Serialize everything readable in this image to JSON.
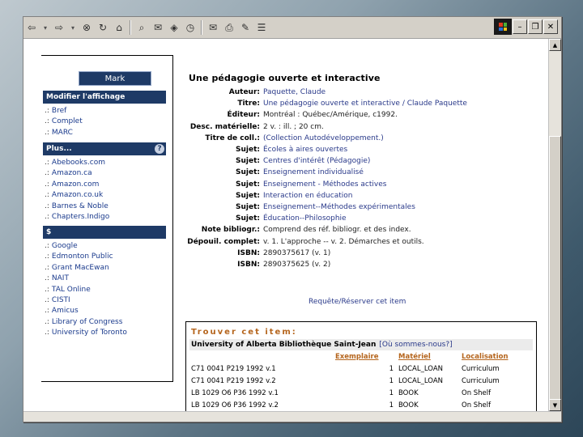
{
  "toolbar": {
    "buttons": [
      {
        "icon": "back-arrow-icon",
        "glyph": "⇦"
      },
      {
        "icon": "dropdown-caret-icon",
        "glyph": "▾"
      },
      {
        "icon": "forward-arrow-icon",
        "glyph": "⇨"
      },
      {
        "icon": "dropdown-caret-icon",
        "glyph": "▾"
      },
      {
        "icon": "stop-icon",
        "glyph": "⊗"
      },
      {
        "icon": "refresh-icon",
        "glyph": "↻"
      },
      {
        "icon": "home-icon",
        "glyph": "⌂"
      },
      {
        "icon": "search-icon",
        "glyph": "⌕"
      },
      {
        "icon": "favorites-icon",
        "glyph": "✉"
      },
      {
        "icon": "media-icon",
        "glyph": "◈"
      },
      {
        "icon": "history-icon",
        "glyph": "◷"
      },
      {
        "icon": "mail-icon",
        "glyph": "✉"
      },
      {
        "icon": "print-icon",
        "glyph": "⎙"
      },
      {
        "icon": "edit-icon",
        "glyph": "✎"
      },
      {
        "icon": "discuss-icon",
        "glyph": "☰"
      }
    ],
    "window_controls": {
      "minimize": "–",
      "restore": "❐",
      "close": "✕"
    }
  },
  "sidebar": {
    "mark_label": "Mark",
    "display_heading": "Modifier l'affichage",
    "display_items": [
      "Bref",
      "Complet",
      "MARC"
    ],
    "more_heading": "Plus...",
    "help_icon": "?",
    "more_items": [
      "Abebooks.com",
      "Amazon.ca",
      "Amazon.com",
      "Amazon.co.uk",
      "Barnes & Noble",
      "Chapters.Indigo"
    ],
    "dollar_heading": "$",
    "dollar_items": [
      "Google",
      "Edmonton Public",
      "Grant MacEwan",
      "NAIT",
      "TAL Online",
      "CISTI",
      "Amicus",
      "Library of Congress",
      "University of Toronto"
    ],
    "bullet": ".:"
  },
  "record": {
    "title": "Une pédagogie ouverte et interactive",
    "fields": [
      {
        "label": "Auteur:",
        "value": "Paquette, Claude",
        "link": true
      },
      {
        "label": "Titre:",
        "value": "Une pédagogie ouverte et interactive / Claude Paquette",
        "link": true
      },
      {
        "label": "Éditeur:",
        "value": "Montréal : Québec/Amérique, c1992.",
        "link": false
      },
      {
        "label": "Desc. matérielle:",
        "value": "2 v. : ill. ; 20 cm.",
        "link": false
      },
      {
        "label": "Titre de coll.:",
        "value": "(Collection Autodéveloppement.)",
        "link": true
      },
      {
        "label": "Sujet:",
        "value": "Écoles à aires ouvertes",
        "link": true
      },
      {
        "label": "Sujet:",
        "value": "Centres d'intérêt (Pédagogie)",
        "link": true
      },
      {
        "label": "Sujet:",
        "value": "Enseignement individualisé",
        "link": true
      },
      {
        "label": "Sujet:",
        "value": "Enseignement - Méthodes actives",
        "link": true
      },
      {
        "label": "Sujet:",
        "value": "Interaction en éducation",
        "link": true
      },
      {
        "label": "Sujet:",
        "value": "Enseignement--Méthodes expérimentales",
        "link": true
      },
      {
        "label": "Sujet:",
        "value": "Éducation--Philosophie",
        "link": true
      },
      {
        "label": "Note bibliogr.:",
        "value": "Comprend des réf. bibliogr. et des index.",
        "link": false
      },
      {
        "label": "Dépouil. complet:",
        "value": "v. 1. L'approche -- v. 2. Démarches et outils.",
        "link": false
      },
      {
        "label": "ISBN:",
        "value": "2890375617 (v. 1)",
        "link": false
      },
      {
        "label": "ISBN:",
        "value": "2890375625 (v. 2)",
        "link": false
      }
    ],
    "request_link": "Requête/Réserver cet item"
  },
  "items": {
    "heading": "Trouver cet item:",
    "library": "University of Alberta Bibliothèque Saint-Jean",
    "where_link": "[Où sommes-nous?]",
    "columns": [
      "Exemplaire",
      "Matériel",
      "Localisation"
    ],
    "rows": [
      {
        "call": "C71 0041 P219 1992 v.1",
        "copy": "1",
        "material": "LOCAL_LOAN",
        "location": "Curriculum"
      },
      {
        "call": "C71 0041 P219 1992 v.2",
        "copy": "1",
        "material": "LOCAL_LOAN",
        "location": "Curriculum"
      },
      {
        "call": "LB 1029 O6 P36 1992 v.1",
        "copy": "1",
        "material": "BOOK",
        "location": "On Shelf"
      },
      {
        "call": "LB 1029 O6 P36 1992 v.2",
        "copy": "1",
        "material": "BOOK",
        "location": "On Shelf"
      }
    ]
  }
}
